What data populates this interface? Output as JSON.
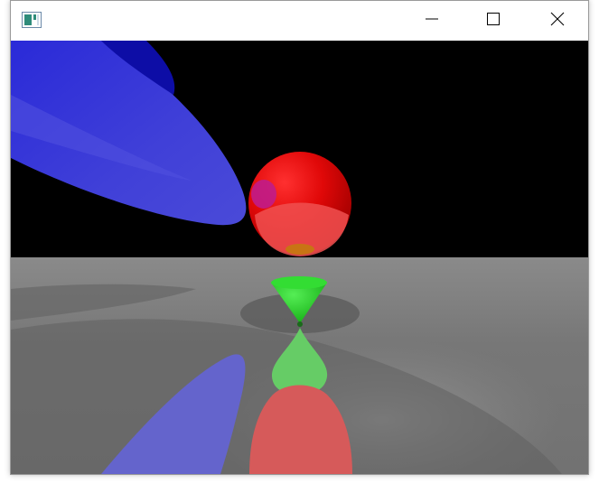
{
  "window": {
    "title": "",
    "icon": "app-window-icon",
    "controls": {
      "minimize_icon": "minimize-icon",
      "maximize_icon": "maximize-icon",
      "close_icon": "close-icon"
    }
  },
  "scene": {
    "background_color": "#000000",
    "floor_color": "#7a7a7a",
    "objects": [
      {
        "name": "blue-ellipsoid",
        "color": "#3d3fd6"
      },
      {
        "name": "red-sphere",
        "color": "#e01010"
      },
      {
        "name": "green-cone",
        "color": "#22cc22"
      }
    ]
  }
}
